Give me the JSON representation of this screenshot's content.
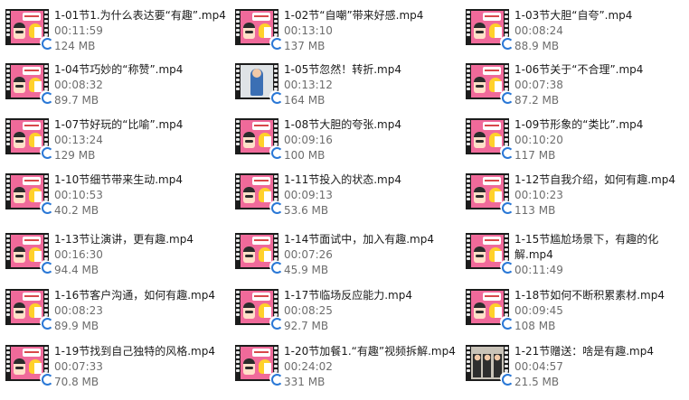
{
  "files": [
    {
      "name": "1-01节1.为什么表达要“有趣”.mp4",
      "duration": "00:11:59",
      "size": "124 MB",
      "thumb": "poster"
    },
    {
      "name": "1-02节“自嘲”带来好感.mp4",
      "duration": "00:13:10",
      "size": "137 MB",
      "thumb": "poster"
    },
    {
      "name": "1-03节大胆“自夸”.mp4",
      "duration": "00:08:24",
      "size": "88.9 MB",
      "thumb": "poster"
    },
    {
      "name": "1-04节巧妙的“称赞”.mp4",
      "duration": "00:08:32",
      "size": "89.7 MB",
      "thumb": "poster"
    },
    {
      "name": "1-05节忽然！转折.mp4",
      "duration": "00:13:12",
      "size": "164 MB",
      "thumb": "photo"
    },
    {
      "name": "1-06节关于“不合理”.mp4",
      "duration": "00:07:38",
      "size": "87.2 MB",
      "thumb": "poster"
    },
    {
      "name": "1-07节好玩的“比喻”.mp4",
      "duration": "00:13:24",
      "size": "129 MB",
      "thumb": "poster"
    },
    {
      "name": "1-08节大胆的夸张.mp4",
      "duration": "00:09:16",
      "size": "100 MB",
      "thumb": "poster"
    },
    {
      "name": "1-09节形象的“类比”.mp4",
      "duration": "00:10:20",
      "size": "117 MB",
      "thumb": "poster"
    },
    {
      "name": "1-10节细节带来生动.mp4",
      "duration": "00:10:53",
      "size": "40.2 MB",
      "thumb": "poster"
    },
    {
      "name": "1-11节投入的状态.mp4",
      "duration": "00:09:13",
      "size": "53.6 MB",
      "thumb": "poster"
    },
    {
      "name": "1-12节自我介绍，如何有趣.mp4",
      "duration": "00:10:23",
      "size": "113 MB",
      "thumb": "poster"
    },
    {
      "name": "1-13节让演讲，更有趣.mp4",
      "duration": "00:16:30",
      "size": "94.4 MB",
      "thumb": "poster"
    },
    {
      "name": "1-14节面试中，加入有趣.mp4",
      "duration": "00:07:26",
      "size": "45.9 MB",
      "thumb": "poster"
    },
    {
      "name": "1-15节尴尬场景下，有趣的化解.mp4",
      "duration": "00:11:49",
      "size": "",
      "thumb": "poster",
      "wrap": true
    },
    {
      "name": "1-16节客户沟通，如何有趣.mp4",
      "duration": "00:08:23",
      "size": "89.9 MB",
      "thumb": "poster"
    },
    {
      "name": "1-17节临场反应能力.mp4",
      "duration": "00:08:25",
      "size": "92.7 MB",
      "thumb": "poster"
    },
    {
      "name": "1-18节如何不断积累素材.mp4",
      "duration": "00:09:45",
      "size": "108 MB",
      "thumb": "poster"
    },
    {
      "name": "1-19节找到自己独特的风格.mp4",
      "duration": "00:07:33",
      "size": "70.8 MB",
      "thumb": "poster"
    },
    {
      "name": "1-20节加餐1.“有趣”视频拆解.mp4",
      "duration": "00:24:02",
      "size": "331 MB",
      "thumb": "poster"
    },
    {
      "name": "1-21节赠送：啥是有趣.mp4",
      "duration": "00:04:57",
      "size": "21.5 MB",
      "thumb": "group"
    }
  ]
}
